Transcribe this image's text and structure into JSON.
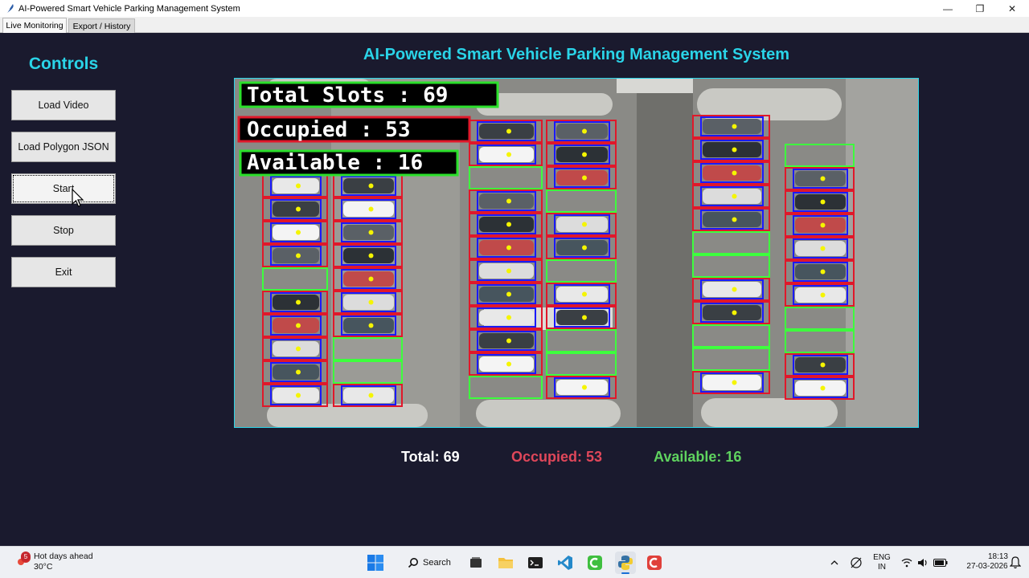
{
  "window": {
    "title": "AI-Powered Smart Vehicle Parking Management System",
    "minimize_glyph": "—",
    "maximize_glyph": "❐",
    "close_glyph": "✕"
  },
  "tabs": [
    {
      "label": "Live Monitoring",
      "active": true
    },
    {
      "label": "Export / History",
      "active": false
    }
  ],
  "controls": {
    "title": "Controls",
    "buttons": {
      "load_video": "Load Video",
      "load_polygon": "Load Polygon JSON",
      "start": "Start",
      "stop": "Stop",
      "exit": "Exit"
    }
  },
  "main": {
    "title": "AI-Powered Smart Vehicle Parking Management System"
  },
  "video": {
    "overlay_total": "Total Slots : 69",
    "overlay_occupied": "Occupied : 53",
    "overlay_available": "Available : 16"
  },
  "stats": {
    "total": "Total: 69",
    "occupied": "Occupied: 53",
    "available": "Available: 16"
  },
  "colors": {
    "accent": "#2ad4e8",
    "occupied": "#e0475a",
    "available": "#5fd35f",
    "background": "#1a1a2e",
    "slot_occupied": "#e0182a",
    "slot_available": "#3dff3d",
    "vehicle_box": "#1a1aff",
    "centroid": "#f5f500"
  },
  "taskbar": {
    "weather_title": "Hot days ahead",
    "weather_temp": "30°C",
    "weather_badge": "5",
    "search_label": "Search",
    "language": "ENG",
    "region": "IN",
    "time": "18:13",
    "date": "27-03-2026"
  }
}
